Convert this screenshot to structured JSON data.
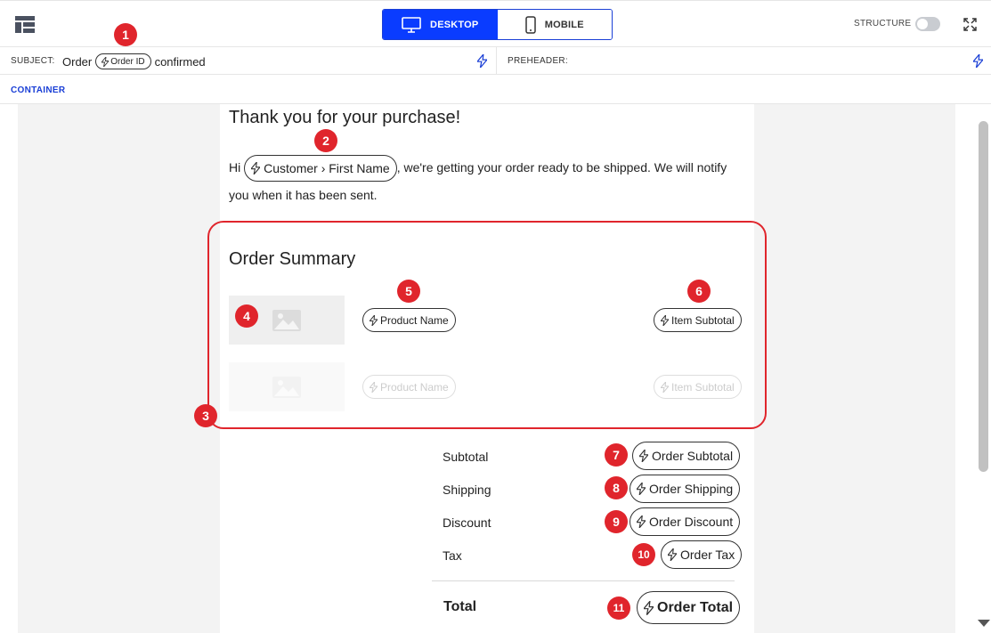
{
  "toolbar": {
    "device_options": [
      {
        "label": "DESKTOP",
        "icon": "monitor-icon",
        "active": true
      },
      {
        "label": "MOBILE",
        "icon": "phone-icon",
        "active": false
      }
    ],
    "structure_label": "STRUCTURE",
    "structure_enabled": false,
    "accent_color": "#0a3cff"
  },
  "subject": {
    "label": "SUBJECT:",
    "prefix": "Order",
    "tag": "Order ID",
    "suffix": "confirmed"
  },
  "preheader": {
    "label": "PREHEADER:"
  },
  "container": {
    "label": "CONTAINER"
  },
  "email": {
    "heading": "Thank you for your purchase!",
    "greeting": "Hi",
    "customer_tag": "Customer › First Name",
    "body_rest": ", we're getting your order ready to be shipped. We will notify you when it has been sent.",
    "summary_heading": "Order Summary",
    "items": [
      {
        "product_tag": "Product Name",
        "subtotal_tag": "Item Subtotal"
      },
      {
        "product_tag": "Product Name",
        "subtotal_tag": "Item Subtotal"
      }
    ],
    "totals": [
      {
        "label": "Subtotal",
        "tag": "Order Subtotal"
      },
      {
        "label": "Shipping",
        "tag": "Order Shipping"
      },
      {
        "label": "Discount",
        "tag": "Order Discount"
      },
      {
        "label": "Tax",
        "tag": "Order Tax"
      }
    ],
    "total": {
      "label": "Total",
      "tag": "Order Total"
    }
  },
  "annotations": {
    "color": "#e0252c",
    "badges": [
      "1",
      "2",
      "3",
      "4",
      "5",
      "6",
      "7",
      "8",
      "9",
      "10",
      "11"
    ]
  }
}
